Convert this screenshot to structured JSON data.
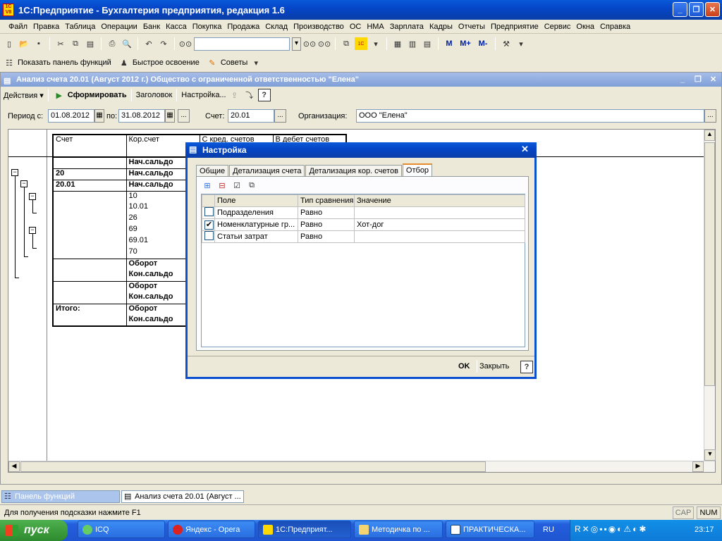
{
  "app": {
    "title": "1С:Предприятие - Бухгалтерия предприятия, редакция 1.6"
  },
  "menu": [
    "Файл",
    "Правка",
    "Таблица",
    "Операции",
    "Банк",
    "Касса",
    "Покупка",
    "Продажа",
    "Склад",
    "Производство",
    "ОС",
    "НМА",
    "Зарплата",
    "Кадры",
    "Отчеты",
    "Предприятие",
    "Сервис",
    "Окна",
    "Справка"
  ],
  "toolbar2": {
    "show_panel": "Показать панель функций",
    "quick_start": "Быстрое освоение",
    "tips": "Советы"
  },
  "doc": {
    "title": "Анализ счета 20.01 (Август 2012 г.) Общество с ограниченной ответственностью \"Елена\"",
    "actions": "Действия",
    "generate": "Сформировать",
    "header": "Заголовок",
    "settings": "Настройка...",
    "help": "?",
    "period_label": "Период с:",
    "period_from": "01.08.2012",
    "period_to_label": "по:",
    "period_to": "31.08.2012",
    "account_label": "Счет:",
    "account": "20.01",
    "org_label": "Организация:",
    "org": "ООО \"Елена\""
  },
  "report": {
    "headers": [
      "Счет",
      "Кор.счет",
      "С кред. счетов",
      "В дебет счетов"
    ],
    "rows": [
      {
        "acc": "",
        "cor": "Нач.сальдо",
        "bold": true
      },
      {
        "acc": "20",
        "cor": "Нач.сальдо",
        "bold": true
      },
      {
        "acc": "20.01",
        "cor": "Нач.сальдо",
        "bold": true
      },
      {
        "acc": "",
        "cor": "10",
        "bold": false
      },
      {
        "acc": "",
        "cor": "10.01",
        "bold": false
      },
      {
        "acc": "",
        "cor": "26",
        "bold": false
      },
      {
        "acc": "",
        "cor": "69",
        "bold": false
      },
      {
        "acc": "",
        "cor": "69.01",
        "bold": false
      },
      {
        "acc": "",
        "cor": "70",
        "bold": false
      },
      {
        "acc": "",
        "cor": "Оборот",
        "bold": true
      },
      {
        "acc": "",
        "cor": "Кон.сальдо",
        "bold": true
      },
      {
        "acc": "",
        "cor": "Оборот",
        "bold": true
      },
      {
        "acc": "",
        "cor": "Кон.сальдо",
        "bold": true
      },
      {
        "acc": "Итого:",
        "cor": "Оборот",
        "bold": true
      },
      {
        "acc": "",
        "cor": "Кон.сальдо",
        "bold": true
      }
    ]
  },
  "dialog": {
    "title": "Настройка",
    "tabs": [
      "Общие",
      "Детализация счета",
      "Детализация кор. счетов",
      "Отбор"
    ],
    "active_tab": "Отбор",
    "columns": [
      "Поле",
      "Тип сравнения",
      "Значение"
    ],
    "rows": [
      {
        "field": "Подразделения",
        "cmp": "Равно",
        "value": "",
        "checked": false
      },
      {
        "field": "Номенклатурные гр...",
        "cmp": "Равно",
        "value": "Хот-дог",
        "checked": true
      },
      {
        "field": "Статьи затрат",
        "cmp": "Равно",
        "value": "",
        "checked": false
      }
    ],
    "ok": "OK",
    "close": "Закрыть",
    "help": "?"
  },
  "panels": {
    "functions": "Панель функций",
    "analysis": "Анализ счета 20.01 (Август ..."
  },
  "status": {
    "hint": "Для получения подсказки нажмите F1",
    "caps": "CAP",
    "num": "NUM"
  },
  "taskbar": {
    "start": "пуск",
    "items": [
      "ICQ",
      "Яндекс - Opera",
      "1С:Предприят...",
      "Методичка по ...",
      "ПРАКТИЧЕСКА..."
    ],
    "lang": "RU",
    "clock": "23:17"
  },
  "colors": {
    "xp_blue": "#0a4fd0",
    "dialog_title": "#0a5ad8",
    "start_green": "#3a9a3a"
  }
}
